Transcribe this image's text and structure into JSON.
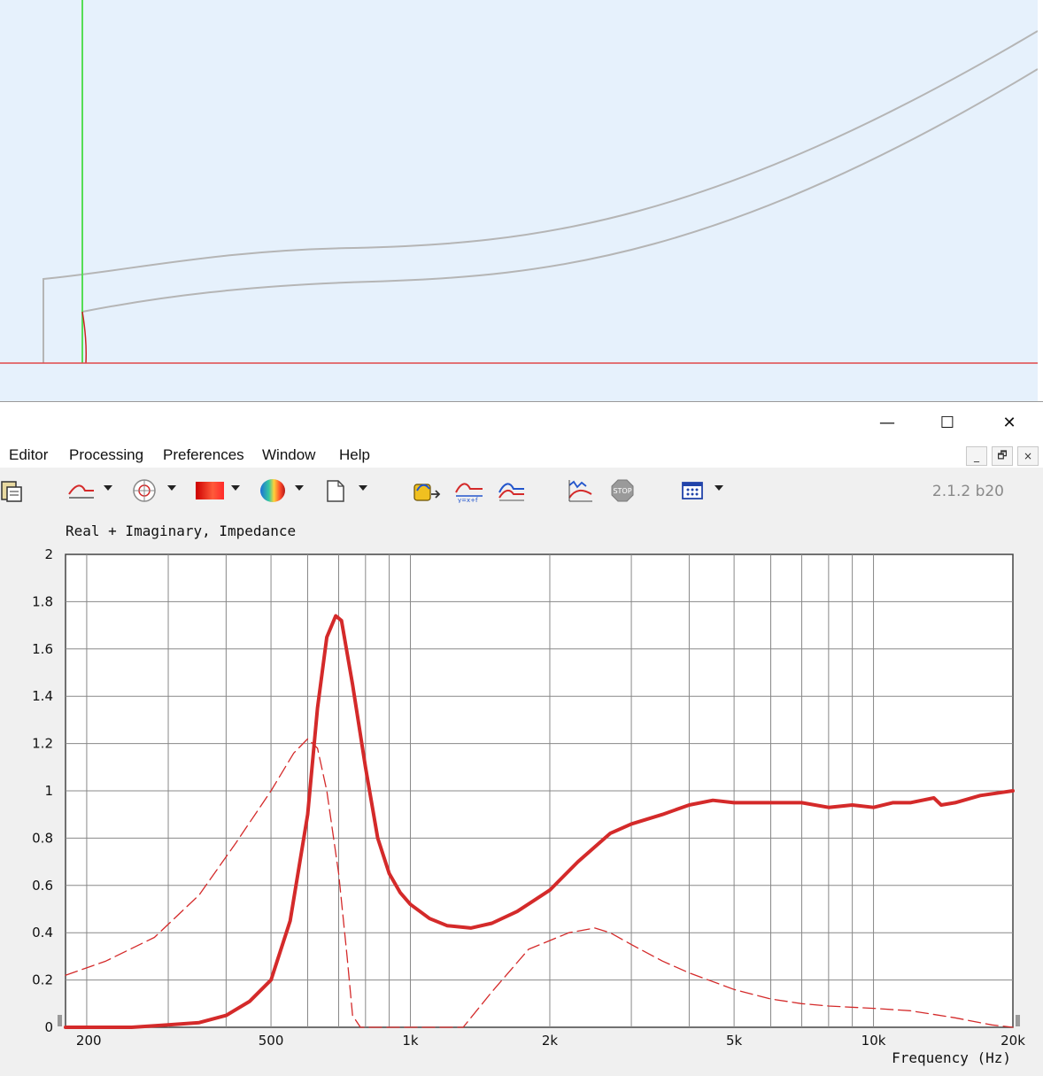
{
  "window": {
    "minimize_glyph": "—",
    "maximize_glyph": "☐",
    "close_glyph": "✕"
  },
  "menu": [
    {
      "label": "Editor"
    },
    {
      "label": "Processing"
    },
    {
      "label": "Preferences"
    },
    {
      "label": "Window"
    },
    {
      "label": "Help"
    }
  ],
  "mdi": {
    "minimize": "_",
    "restore": "🗗",
    "close": "×"
  },
  "toolbar": {
    "version": "2.1.2 b20",
    "icons": [
      "clipboard-icon",
      "frequency-plot-icon",
      "polar-plot-icon",
      "sonogram-icon",
      "balloon-icon",
      "document-icon",
      "export-icon",
      "formula-icon",
      "overlay-icon",
      "measurement-icon",
      "stop-icon",
      "grid-settings-icon"
    ],
    "stop_label": "STOP"
  },
  "chart_data": {
    "type": "line",
    "title": "Real + Imaginary, Impedance",
    "xlabel": "Frequency (Hz)",
    "ylabel": "",
    "xscale": "log",
    "xlim": [
      180,
      20000
    ],
    "ylim": [
      0,
      2
    ],
    "grid": true,
    "x_tick_labels": [
      {
        "value": 200,
        "label": "200"
      },
      {
        "value": 500,
        "label": "500"
      },
      {
        "value": 1000,
        "label": "1k"
      },
      {
        "value": 2000,
        "label": "2k"
      },
      {
        "value": 5000,
        "label": "5k"
      },
      {
        "value": 10000,
        "label": "10k"
      },
      {
        "value": 20000,
        "label": "20k"
      }
    ],
    "y_ticks": [
      0,
      0.2,
      0.4,
      0.6,
      0.8,
      1,
      1.2,
      1.4,
      1.6,
      1.8,
      2
    ],
    "y_tick_labels": [
      "0",
      "0.2",
      "0.4",
      "0.6",
      "0.8",
      "1",
      "1.2",
      "1.4",
      "1.6",
      "1.8",
      "2"
    ],
    "series": [
      {
        "style": "solid",
        "color": "#d42a2a",
        "x": [
          180,
          250,
          300,
          350,
          400,
          450,
          500,
          550,
          600,
          630,
          660,
          690,
          710,
          750,
          800,
          850,
          900,
          950,
          1000,
          1100,
          1200,
          1350,
          1500,
          1700,
          2000,
          2300,
          2700,
          3000,
          3500,
          4000,
          4500,
          5000,
          6000,
          7000,
          8000,
          9000,
          10000,
          11000,
          12000,
          13500,
          14000,
          15000,
          17000,
          20000
        ],
        "y": [
          0,
          0,
          0.01,
          0.02,
          0.05,
          0.11,
          0.2,
          0.45,
          0.9,
          1.35,
          1.65,
          1.74,
          1.72,
          1.45,
          1.1,
          0.8,
          0.65,
          0.57,
          0.52,
          0.46,
          0.43,
          0.42,
          0.44,
          0.49,
          0.58,
          0.7,
          0.82,
          0.86,
          0.9,
          0.94,
          0.96,
          0.95,
          0.95,
          0.95,
          0.93,
          0.94,
          0.93,
          0.95,
          0.95,
          0.97,
          0.94,
          0.95,
          0.98,
          1.0
        ]
      },
      {
        "style": "dashed",
        "color": "#d42a2a",
        "x": [
          180,
          220,
          280,
          350,
          420,
          500,
          560,
          600,
          630,
          660,
          700,
          730,
          750,
          780,
          800,
          1000,
          1300,
          1500,
          1800,
          2200,
          2500,
          2700,
          3000,
          3500,
          4000,
          5000,
          6000,
          7000,
          8000,
          10000,
          12000,
          15000,
          18000,
          20000
        ],
        "y": [
          0.22,
          0.28,
          0.38,
          0.56,
          0.78,
          1.0,
          1.16,
          1.22,
          1.18,
          1.0,
          0.65,
          0.3,
          0.05,
          0,
          0,
          0,
          0,
          0.15,
          0.33,
          0.4,
          0.42,
          0.4,
          0.35,
          0.28,
          0.23,
          0.16,
          0.12,
          0.1,
          0.09,
          0.08,
          0.07,
          0.04,
          0.01,
          0
        ]
      }
    ]
  }
}
